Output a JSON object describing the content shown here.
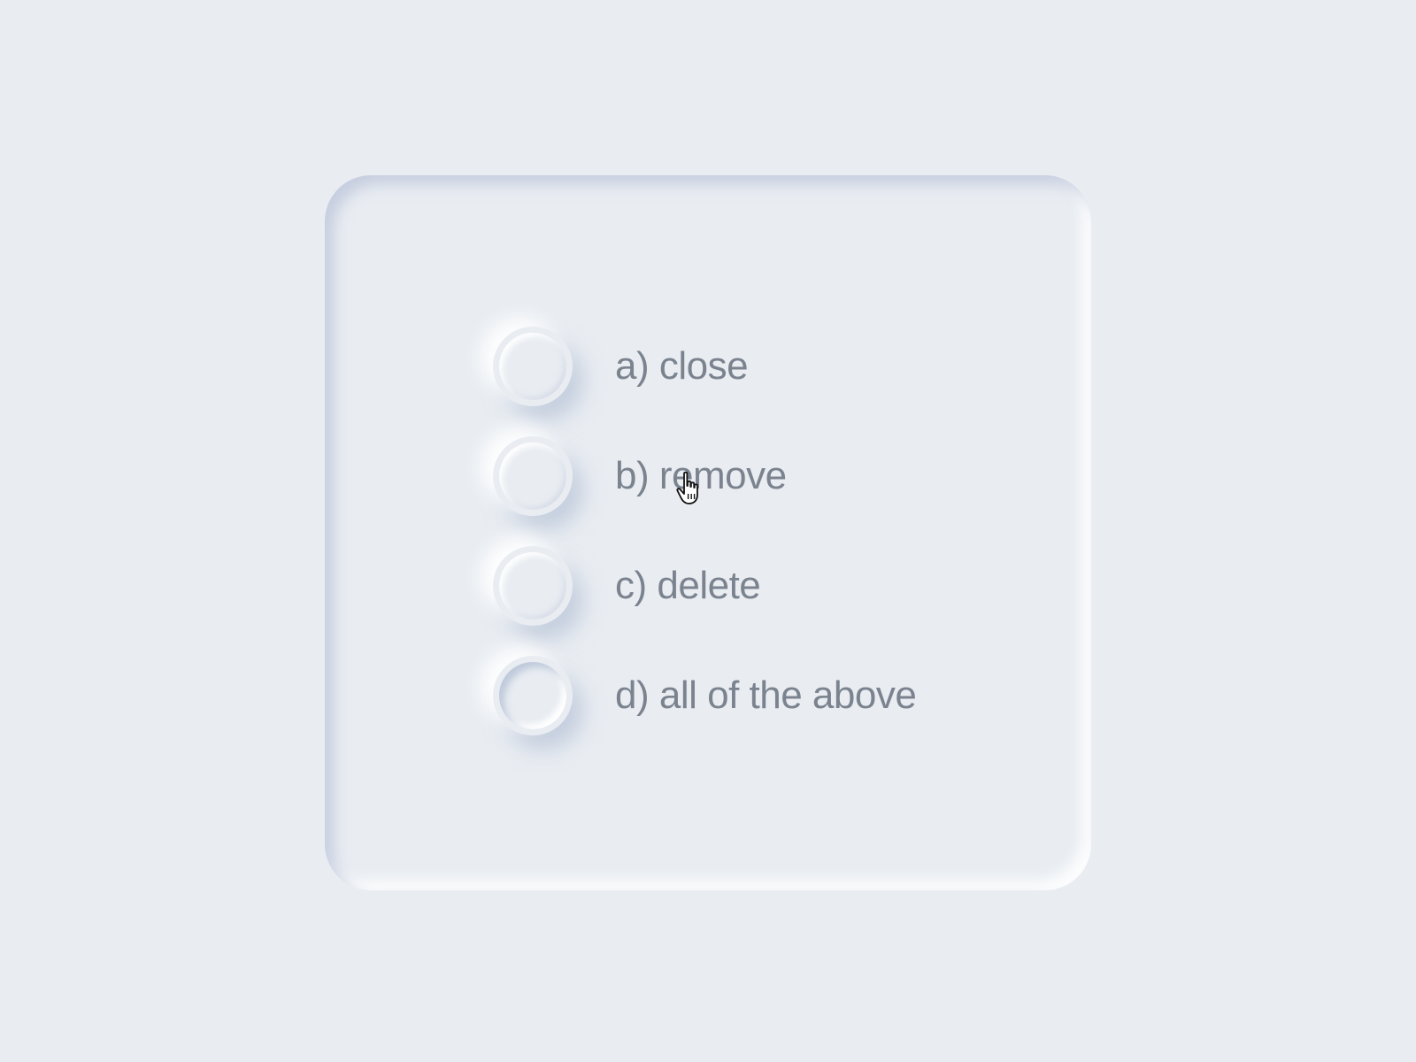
{
  "quiz": {
    "options": [
      {
        "label": "a) close",
        "selected": false
      },
      {
        "label": "b) remove",
        "selected": false
      },
      {
        "label": "c) delete",
        "selected": false
      },
      {
        "label": "d) all of the above",
        "selected": false
      }
    ]
  },
  "cursor": {
    "type": "pointer-hand",
    "icon": "hand-cursor-icon"
  },
  "colors": {
    "background": "#e9edf2",
    "label_text": "#7b838f"
  }
}
